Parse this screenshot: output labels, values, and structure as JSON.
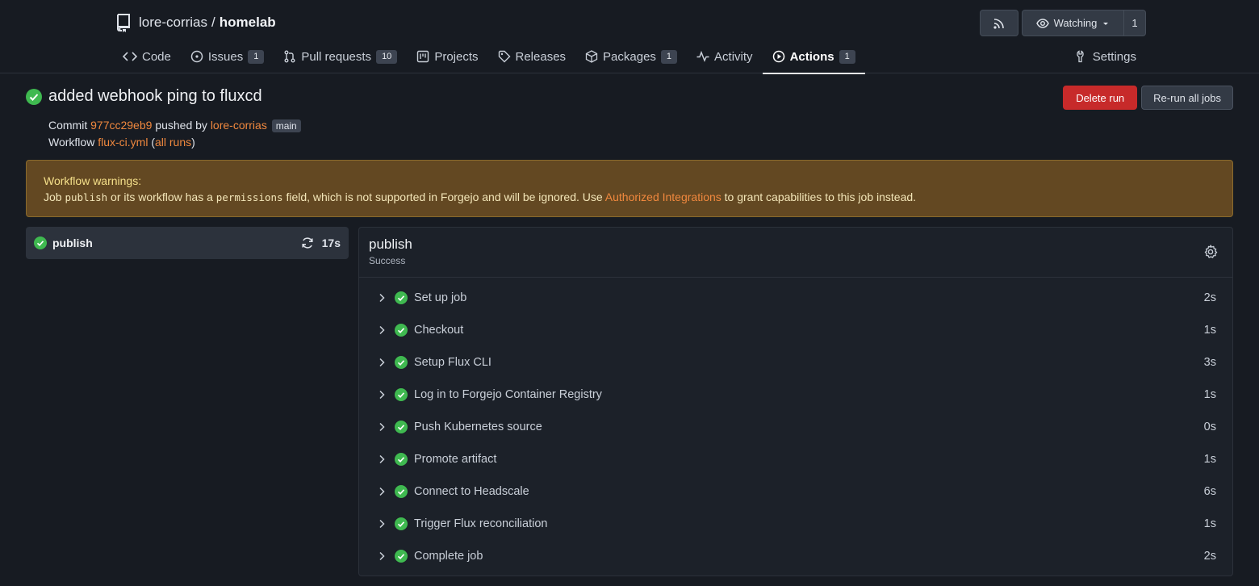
{
  "repo": {
    "owner": "lore-corrias",
    "separator": "/",
    "name": "homelab",
    "watch_label": "Watching",
    "watch_count": "1"
  },
  "tabs": [
    {
      "label": "Code",
      "icon": "code-icon"
    },
    {
      "label": "Issues",
      "badge": "1",
      "icon": "issue-icon"
    },
    {
      "label": "Pull requests",
      "badge": "10",
      "icon": "pull-request-icon"
    },
    {
      "label": "Projects",
      "icon": "project-icon"
    },
    {
      "label": "Releases",
      "icon": "tag-icon"
    },
    {
      "label": "Packages",
      "badge": "1",
      "icon": "package-icon"
    },
    {
      "label": "Activity",
      "icon": "pulse-icon"
    },
    {
      "label": "Actions",
      "badge": "1",
      "icon": "play-icon",
      "active": true
    },
    {
      "label": "Settings",
      "icon": "tools-icon"
    }
  ],
  "run": {
    "title": "added webhook ping to fluxcd",
    "commit_label": "Commit",
    "commit_sha": "977cc29eb9",
    "pushed_by_label": "pushed by",
    "author": "lore-corrias",
    "branch": "main",
    "workflow_label": "Workflow",
    "workflow_file": "flux-ci.yml",
    "all_runs": "all runs",
    "delete_label": "Delete run",
    "rerun_label": "Re-run all jobs"
  },
  "warning": {
    "title": "Workflow warnings:",
    "text_1": "Job",
    "code_1": "publish",
    "text_2": "or its workflow has a",
    "code_2": "permissions",
    "text_3": "field, which is not supported in Forgejo and will be ignored. Use",
    "link": "Authorized Integrations",
    "text_4": "to grant capabilities to this job instead."
  },
  "job": {
    "name": "publish",
    "duration": "17s",
    "status": "Success"
  },
  "steps": [
    {
      "name": "Set up job",
      "duration": "2s"
    },
    {
      "name": "Checkout",
      "duration": "1s"
    },
    {
      "name": "Setup Flux CLI",
      "duration": "3s"
    },
    {
      "name": "Log in to Forgejo Container Registry",
      "duration": "1s"
    },
    {
      "name": "Push Kubernetes source",
      "duration": "0s"
    },
    {
      "name": "Promote artifact",
      "duration": "1s"
    },
    {
      "name": "Connect to Headscale",
      "duration": "6s"
    },
    {
      "name": "Trigger Flux reconciliation",
      "duration": "1s"
    },
    {
      "name": "Complete job",
      "duration": "2s"
    }
  ],
  "colors": {
    "success": "#3fb950",
    "accent_link": "#f0883e",
    "danger": "#c72a2a",
    "warning_bg": "#634822"
  }
}
